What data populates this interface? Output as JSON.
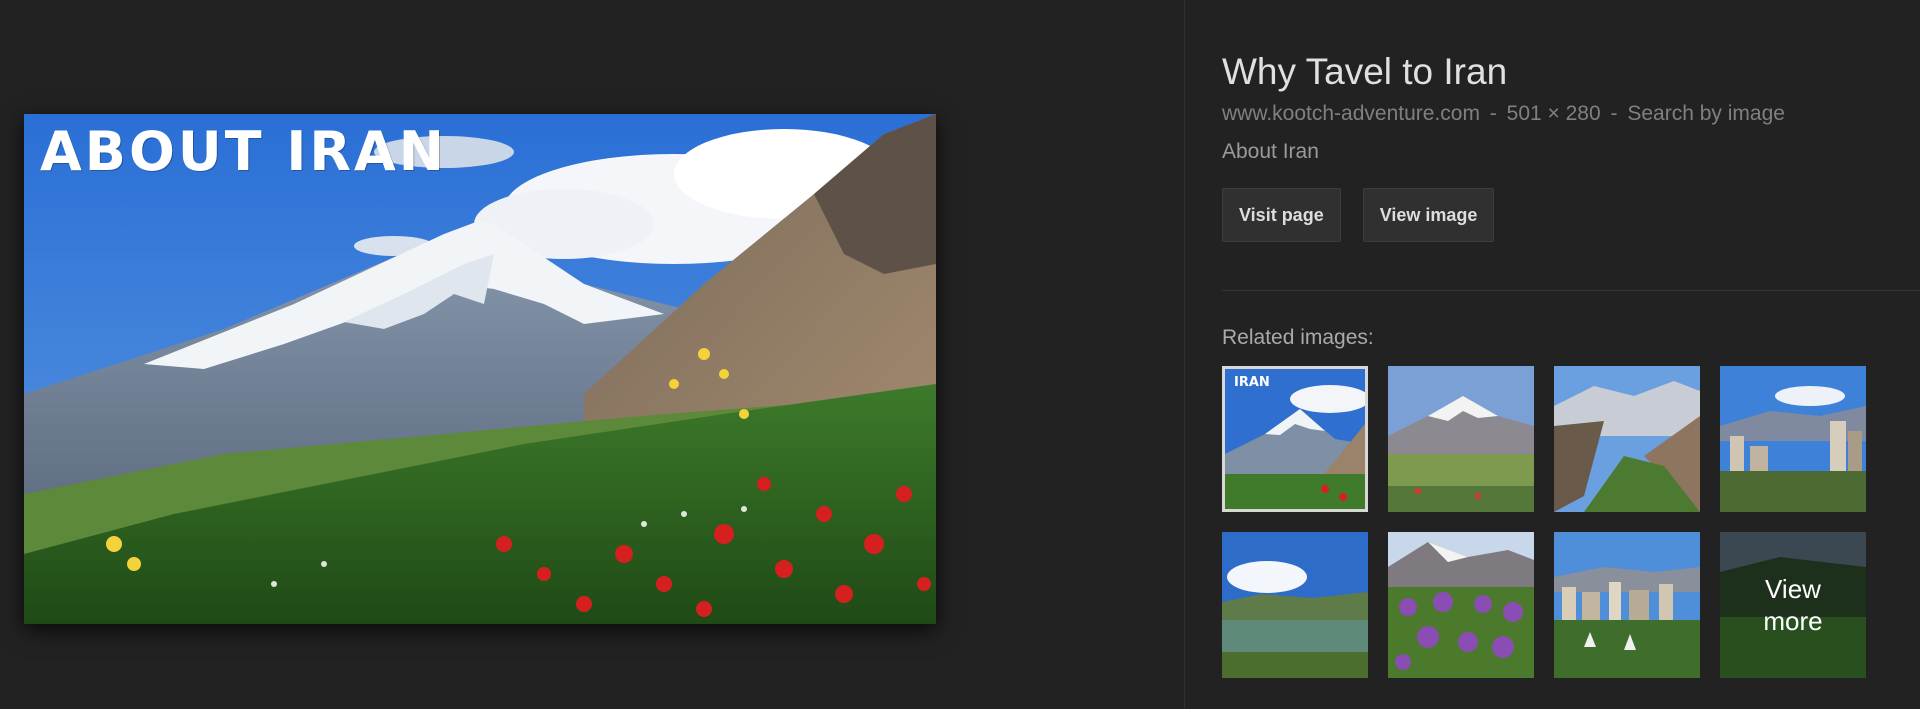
{
  "preview": {
    "caption": "ABOUT IRAN"
  },
  "info": {
    "title": "Why Tavel to Iran",
    "domain": "www.kootch-adventure.com",
    "separator": "-",
    "dimensions": "501 × 280",
    "search_by_image": "Search by image",
    "description": "About Iran"
  },
  "buttons": {
    "visit_page": "Visit page",
    "view_image": "View image"
  },
  "related": {
    "label": "Related images:",
    "first_thumb_tag": "IRAN",
    "view_more": "View more"
  }
}
